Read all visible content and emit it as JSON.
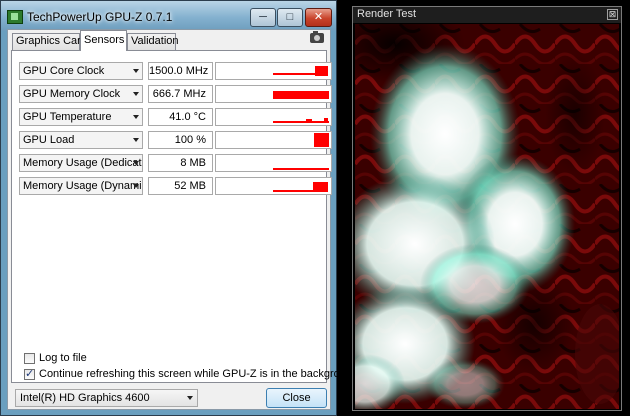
{
  "gpuz": {
    "title": "TechPowerUp GPU-Z 0.7.1",
    "caption_buttons": {
      "minimize": "─",
      "maximize": "□",
      "close": "✕"
    },
    "tabs": [
      {
        "label": "Graphics Card",
        "active": false
      },
      {
        "label": "Sensors",
        "active": true
      },
      {
        "label": "Validation",
        "active": false
      }
    ],
    "sensors": [
      {
        "name": "GPU Core Clock",
        "value": "1500.0 MHz"
      },
      {
        "name": "GPU Memory Clock",
        "value": "666.7 MHz"
      },
      {
        "name": "GPU Temperature",
        "value": "41.0 °C"
      },
      {
        "name": "GPU Load",
        "value": "100 %"
      },
      {
        "name": "Memory Usage (Dedicated)",
        "value": "8 MB"
      },
      {
        "name": "Memory Usage (Dynamic)",
        "value": "52 MB"
      }
    ],
    "log_to_file": {
      "label": "Log to file",
      "checked": false
    },
    "continue_refresh": {
      "label": "Continue refreshing this screen while GPU-Z is in the background",
      "checked": true
    },
    "device_select": {
      "value": "Intel(R) HD Graphics 4600"
    },
    "close_button": "Close",
    "bar_color": "#ff0000"
  },
  "render_test": {
    "title": "Render Test",
    "close": "⊠"
  }
}
